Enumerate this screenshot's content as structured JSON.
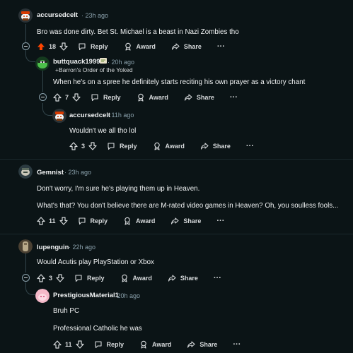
{
  "comments": [
    {
      "username": "accursedcelt",
      "time": "23h ago",
      "text": "Bro was done dirty. Bet St. Michael is a beast in Nazi Zombies tho",
      "votes": "18",
      "upvoted": true
    },
    {
      "username": "buttquack1999",
      "time": "20h ago",
      "flair": "+Barron's Order of the Yoked",
      "text": "When he's on a spree he definitely starts reciting his own prayer as a victory chant",
      "votes": "7"
    },
    {
      "username": "accursedcelt",
      "time": "11h ago",
      "text": "Wouldn't we all tho lol",
      "votes": "3"
    },
    {
      "username": "Gemnist",
      "time": "23h ago",
      "text": "Don't worry, I'm sure he's playing them up in Heaven.",
      "text2": "What's that? You don't believe there are M-rated video games in Heaven? Oh, you soulless fools...",
      "votes": "11"
    },
    {
      "username": "lupenguin",
      "time": "22h ago",
      "text": "Would Acutis play PlayStation or Xbox",
      "votes": "3"
    },
    {
      "username": "PrestigiousMaterial1",
      "time": "20h ago",
      "text": "Bruh PC",
      "text2": "Professional Catholic he was",
      "votes": "11"
    }
  ],
  "actions": {
    "reply": "Reply",
    "award": "Award",
    "share": "Share",
    "more": "···"
  },
  "separator": "·",
  "colors": {
    "background": "#0b1416",
    "upvote_active": "#ff4500",
    "thread_line": "#33464c",
    "meta_text": "#8ba2ad"
  }
}
